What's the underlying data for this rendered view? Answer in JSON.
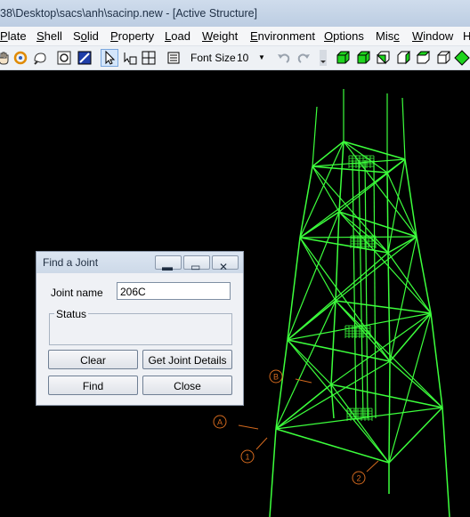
{
  "window": {
    "title": "38\\Desktop\\sacs\\anh\\sacinp.new - [Active Structure]"
  },
  "menu": [
    {
      "label": "Plate",
      "ul": "P"
    },
    {
      "label": "Shell",
      "ul": "S"
    },
    {
      "label": "Solid",
      "ul": "o"
    },
    {
      "label": "Property",
      "ul": "P"
    },
    {
      "label": "Load",
      "ul": "L"
    },
    {
      "label": "Weight",
      "ul": "W"
    },
    {
      "label": "Environment",
      "ul": "E"
    },
    {
      "label": "Options",
      "ul": "O"
    },
    {
      "label": "Misc",
      "ul": "c"
    },
    {
      "label": "Window",
      "ul": "W"
    },
    {
      "label": "H",
      "ul": ""
    }
  ],
  "toolbar": {
    "font_size_label": "Font Size",
    "font_size_value": "10"
  },
  "dialog": {
    "title": "Find a Joint",
    "joint_name_label": "Joint name",
    "joint_name_value": "206C",
    "status_label": "Status",
    "status_text": "",
    "buttons": {
      "clear": "Clear",
      "details": "Get Joint Details",
      "find": "Find",
      "close": "Close"
    }
  },
  "viewport": {
    "structure_color": "#3cff3c",
    "marker_color": "#d2691e",
    "row_markers": [
      "A",
      "B"
    ],
    "column_markers": [
      "1",
      "2"
    ]
  }
}
